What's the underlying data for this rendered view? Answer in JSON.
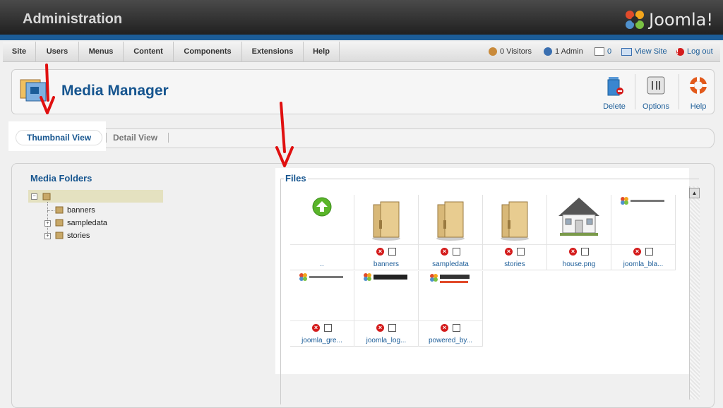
{
  "app": {
    "title": "Administration",
    "brand": "Joomla!"
  },
  "menu": {
    "items": [
      "Site",
      "Users",
      "Menus",
      "Content",
      "Components",
      "Extensions",
      "Help"
    ],
    "visitors": "0 Visitors",
    "admins": "1 Admin",
    "messages": "0",
    "view_site": "View Site",
    "logout": "Log out"
  },
  "toolbar": {
    "page_title": "Media Manager",
    "delete_label": "Delete",
    "options_label": "Options",
    "help_label": "Help"
  },
  "tabs": {
    "thumbnail": "Thumbnail View",
    "detail": "Detail View"
  },
  "folders": {
    "title": "Media Folders",
    "items": [
      "banners",
      "sampledata",
      "stories"
    ]
  },
  "files": {
    "legend": "Files",
    "items": [
      {
        "name": "..",
        "type": "up"
      },
      {
        "name": "banners",
        "type": "folder"
      },
      {
        "name": "sampledata",
        "type": "folder"
      },
      {
        "name": "stories",
        "type": "folder"
      },
      {
        "name": "house.png",
        "type": "house"
      },
      {
        "name": "joomla_bla...",
        "type": "logo-dark"
      },
      {
        "name": "joomla_gre...",
        "type": "logo-dark"
      },
      {
        "name": "joomla_log...",
        "type": "logo-light"
      },
      {
        "name": "powered_by...",
        "type": "logo-powered"
      }
    ]
  },
  "colors": {
    "accent": "#16558f",
    "header_bar": "#1c5d98",
    "delete_red": "#d41c1c",
    "arrow_red": "#e01010"
  }
}
